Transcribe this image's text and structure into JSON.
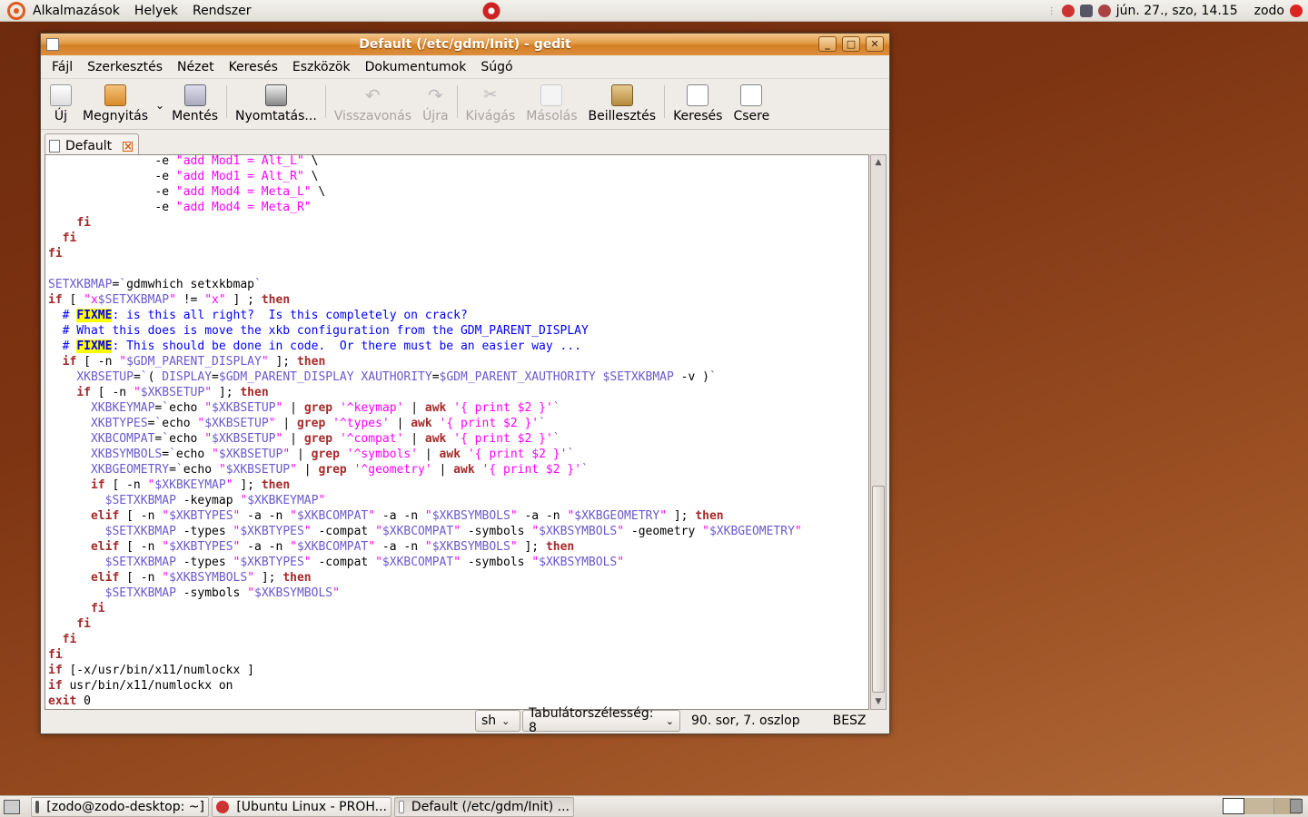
{
  "top_panel": {
    "applications": "Alkalmazások",
    "places": "Helyek",
    "system": "Rendszer",
    "clock": "jún. 27., szo, 14.15",
    "user": "zodo"
  },
  "window": {
    "title": "Default (/etc/gdm/Init) - gedit"
  },
  "menu": [
    "Fájl",
    "Szerkesztés",
    "Nézet",
    "Keresés",
    "Eszközök",
    "Dokumentumok",
    "Súgó"
  ],
  "toolbar": {
    "new": "Új",
    "open": "Megnyitás",
    "save": "Mentés",
    "print": "Nyomtatás...",
    "undo": "Visszavonás",
    "redo": "Újra",
    "cut": "Kivágás",
    "copy": "Másolás",
    "paste": "Beillesztés",
    "find": "Keresés",
    "replace": "Csere"
  },
  "tab": {
    "label": "Default"
  },
  "code_lines": [
    "               -e \"add Mod1 = Alt_L\" \\",
    "               -e \"add Mod1 = Alt_R\" \\",
    "               -e \"add Mod4 = Meta_L\" \\",
    "               -e \"add Mod4 = Meta_R\"",
    "    fi",
    "  fi",
    "fi",
    "",
    "SETXKBMAP=`gdmwhich setxkbmap`",
    "if [ \"x$SETXKBMAP\" != \"x\" ] ; then",
    "  # FIXME: is this all right?  Is this completely on crack?",
    "  # What this does is move the xkb configuration from the GDM_PARENT_DISPLAY",
    "  # FIXME: This should be done in code.  Or there must be an easier way ...",
    "  if [ -n \"$GDM_PARENT_DISPLAY\" ]; then",
    "    XKBSETUP=`( DISPLAY=$GDM_PARENT_DISPLAY XAUTHORITY=$GDM_PARENT_XAUTHORITY $SETXKBMAP -v )`",
    "    if [ -n \"$XKBSETUP\" ]; then",
    "      XKBKEYMAP=`echo \"$XKBSETUP\" | grep '^keymap' | awk '{ print $2 }'`",
    "      XKBTYPES=`echo \"$XKBSETUP\" | grep '^types' | awk '{ print $2 }'`",
    "      XKBCOMPAT=`echo \"$XKBSETUP\" | grep '^compat' | awk '{ print $2 }'`",
    "      XKBSYMBOLS=`echo \"$XKBSETUP\" | grep '^symbols' | awk '{ print $2 }'`",
    "      XKBGEOMETRY=`echo \"$XKBSETUP\" | grep '^geometry' | awk '{ print $2 }'`",
    "      if [ -n \"$XKBKEYMAP\" ]; then",
    "        $SETXKBMAP -keymap \"$XKBKEYMAP\"",
    "      elif [ -n \"$XKBTYPES\" -a -n \"$XKBCOMPAT\" -a -n \"$XKBSYMBOLS\" -a -n \"$XKBGEOMETRY\" ]; then",
    "        $SETXKBMAP -types \"$XKBTYPES\" -compat \"$XKBCOMPAT\" -symbols \"$XKBSYMBOLS\" -geometry \"$XKBGEOMETRY\"",
    "      elif [ -n \"$XKBTYPES\" -a -n \"$XKBCOMPAT\" -a -n \"$XKBSYMBOLS\" ]; then",
    "        $SETXKBMAP -types \"$XKBTYPES\" -compat \"$XKBCOMPAT\" -symbols \"$XKBSYMBOLS\"",
    "      elif [ -n \"$XKBSYMBOLS\" ]; then",
    "        $SETXKBMAP -symbols \"$XKBSYMBOLS\"",
    "      fi",
    "    fi",
    "  fi",
    "fi",
    "if [-x/usr/bin/x11/numlockx ]",
    "if usr/bin/x11/numlockx on",
    "exit 0"
  ],
  "status": {
    "language": "sh",
    "tab_width": "Tabulátorszélesség: 8",
    "position": "90. sor, 7. oszlop",
    "mode": "BESZ"
  },
  "taskbar": [
    {
      "label": "[zodo@zodo-desktop: ~]"
    },
    {
      "label": "[Ubuntu Linux - PROH..."
    },
    {
      "label": "Default (/etc/gdm/Init) ..."
    }
  ],
  "colors": {
    "keyword": "#a52a2a",
    "string": "#ff00ff",
    "variable": "#6a5acd",
    "comment": "#0000ff",
    "titlebar": "#d47f23"
  }
}
